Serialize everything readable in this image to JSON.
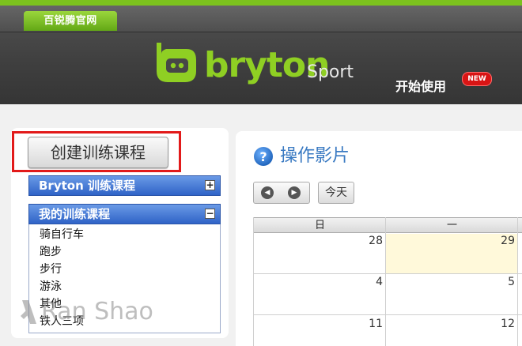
{
  "header": {
    "official_site_tab": "百锐腾官网",
    "brand_word": "bryton",
    "brand_suffix": "Sport",
    "start_link": "开始使用",
    "new_badge": "NEW",
    "accent_green": "#8fcf23",
    "badge_red": "#d81515"
  },
  "sidebar": {
    "create_button": "创建训练课程",
    "bryton_courses": {
      "label": "Bryton 训练课程",
      "toggle": "+"
    },
    "my_courses": {
      "label": "我的训练课程",
      "toggle": "−",
      "items": [
        {
          "label": "骑自行车"
        },
        {
          "label": "跑步"
        },
        {
          "label": "步行"
        },
        {
          "label": "游泳"
        },
        {
          "label": "其他"
        },
        {
          "label": "铁人三项"
        }
      ]
    },
    "header_blue": "#2f63c7",
    "highlight_red": "#e21a1a"
  },
  "main": {
    "section_title": "操作影片",
    "prev_icon": "chevron-left-icon",
    "next_icon": "chevron-right-icon",
    "today_button": "今天",
    "calendar": {
      "weekdays": [
        "日",
        "一"
      ],
      "rows": [
        [
          "28",
          "29"
        ],
        [
          "4",
          "5"
        ],
        [
          "11",
          "12"
        ]
      ],
      "today_highlight": "#fff9da"
    }
  },
  "watermark": {
    "text": "Ran Shao"
  }
}
